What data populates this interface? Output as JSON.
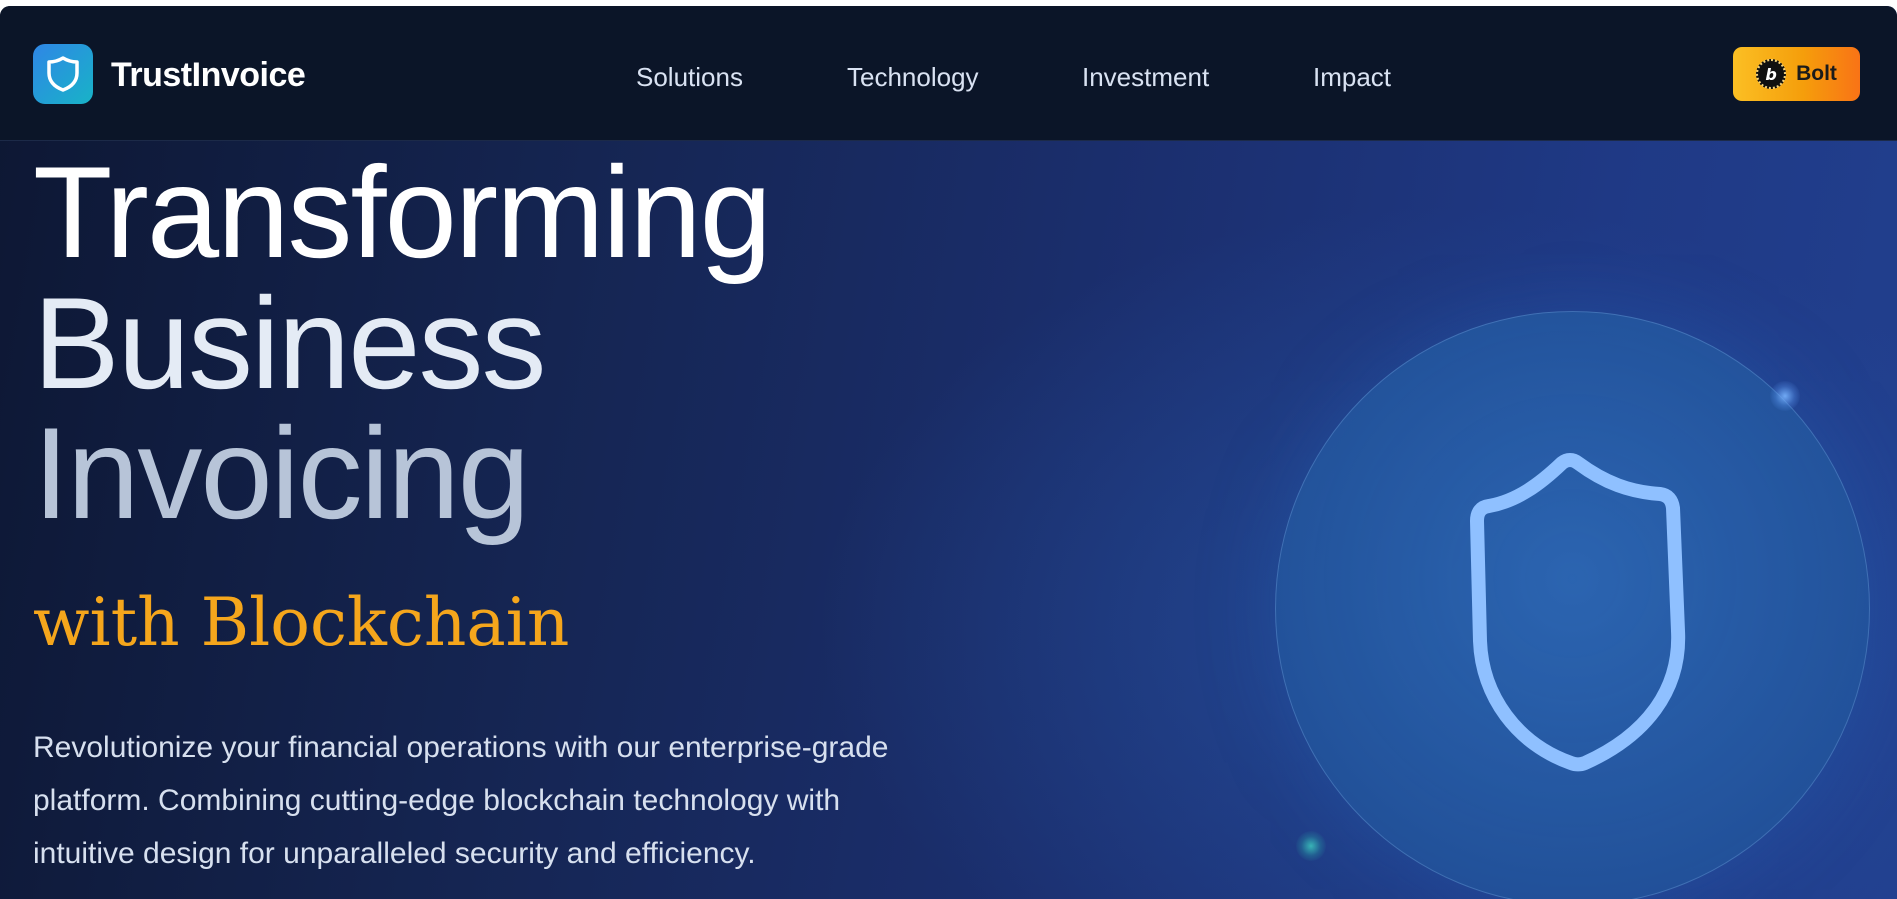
{
  "brand": {
    "name": "TrustInvoice",
    "logo_icon": "shield-icon"
  },
  "nav": {
    "links": [
      {
        "label": "Solutions"
      },
      {
        "label": "Technology"
      },
      {
        "label": "Investment"
      },
      {
        "label": "Impact"
      }
    ],
    "cta": {
      "label": "Bolt",
      "icon": "bolt-coin-icon",
      "coin_letter": "b"
    }
  },
  "hero": {
    "headline": [
      "Transforming",
      "Business",
      "Invoicing"
    ],
    "accent": "with Blockchain",
    "description": "Revolutionize your financial operations with our enterprise-grade platform. Combining cutting-edge blockchain technology with intuitive design for unparalleled security and efficiency.",
    "illustration_icon": "shield-outline-icon"
  },
  "colors": {
    "accent": "#f5a61c",
    "nav_bg": "#0b1528",
    "cta_gradient_start": "#fbbf24",
    "cta_gradient_end": "#f97316",
    "logo_gradient_start": "#2f86e6",
    "logo_gradient_end": "#18b3c7"
  }
}
